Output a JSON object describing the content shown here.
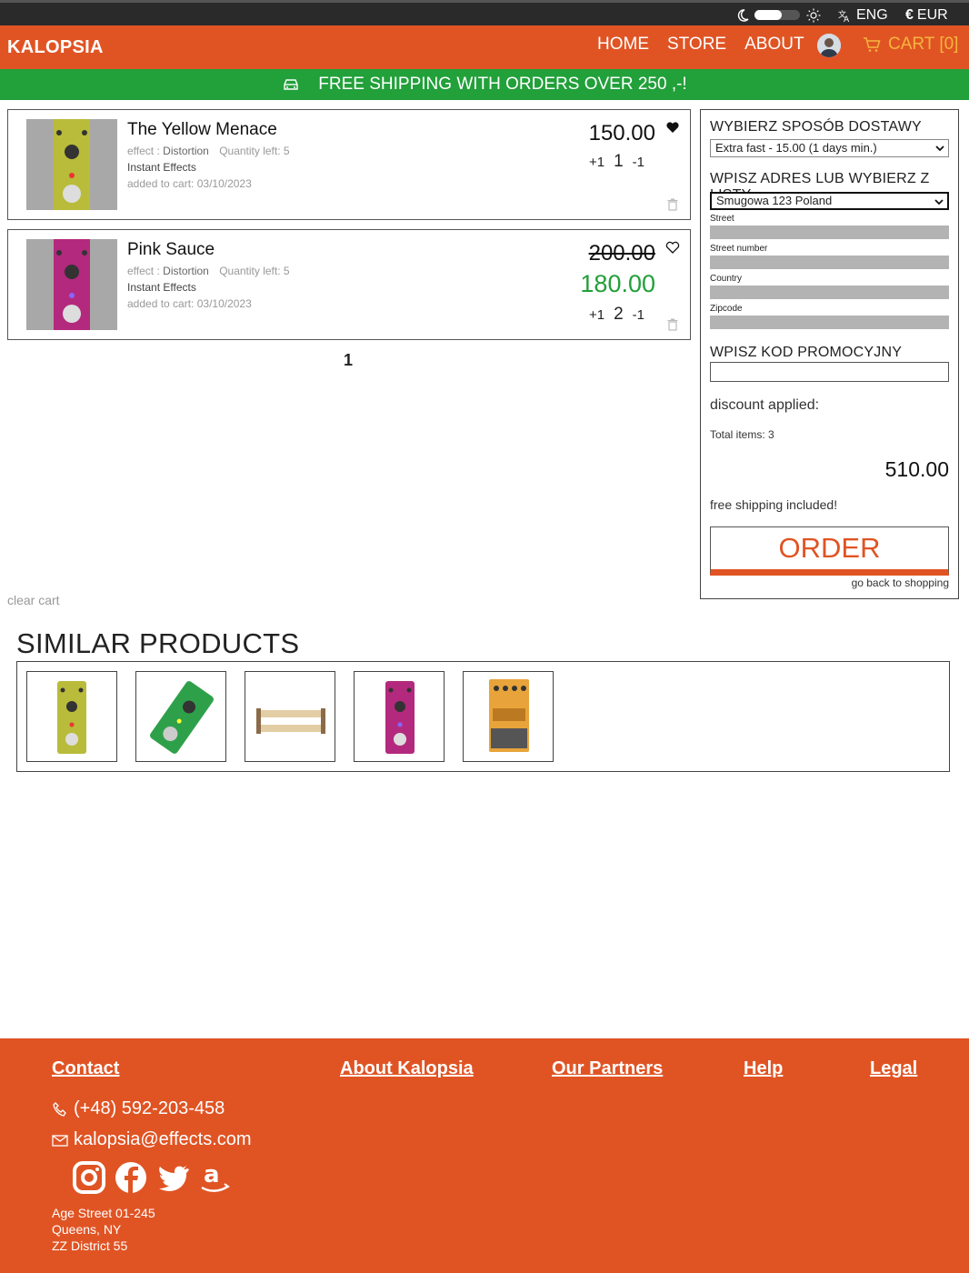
{
  "topbar": {
    "language": "ENG",
    "currency": "EUR"
  },
  "nav": {
    "logo": "KALOPSIA",
    "links": [
      "HOME",
      "STORE",
      "ABOUT"
    ],
    "cart_label": "CART [0]"
  },
  "banner": {
    "text": "FREE SHIPPING WITH ORDERS OVER 250 ,-!"
  },
  "cart": {
    "items": [
      {
        "name": "The Yellow Menace",
        "effect_label": "effect :",
        "effect": "Distortion",
        "quantity_left": "Quantity left: 5",
        "brand": "Instant Effects",
        "added": "added to cart: 03/10/2023",
        "price": "150.00",
        "qty_plus": "+1",
        "qty": "1",
        "qty_minus": "-1",
        "favorite": true
      },
      {
        "name": "Pink Sauce",
        "effect_label": "effect :",
        "effect": "Distortion",
        "quantity_left": "Quantity left: 5",
        "brand": "Instant Effects",
        "added": "added to cart: 03/10/2023",
        "old_price": "200.00",
        "price": "180.00",
        "qty_plus": "+1",
        "qty": "2",
        "qty_minus": "-1",
        "favorite": false
      }
    ],
    "page": "1",
    "clear_label": "clear cart"
  },
  "checkout": {
    "delivery_label": "WYBIERZ SPOSÓB DOSTAWY",
    "delivery_value": "Extra fast - 15.00 (1 days min.)",
    "address_label": "WPISZ ADRES LUB WYBIERZ Z LISTY",
    "address_value": "Smugowa 123 Poland",
    "fields": [
      "Street",
      "Street number",
      "Country",
      "Zipcode"
    ],
    "promo_label": "WPISZ KOD PROMOCYJNY",
    "promo_value": "",
    "discount": "discount applied:",
    "total_items": "Total items: 3",
    "total": "510.00",
    "free_shipping": "free shipping included!",
    "order_label": "ORDER",
    "back_label": "go back to shopping"
  },
  "similar": {
    "title": "SIMILAR PRODUCTS",
    "products": [
      "yellow-pedal",
      "green-pedal",
      "pedalboard",
      "pink-pedal",
      "orange-boss-pedal"
    ]
  },
  "footer": {
    "links": [
      "Contact",
      "About Kalopsia",
      "Our Partners",
      "Help",
      "Legal"
    ],
    "phone": "(+48) 592-203-458",
    "email": "kalopsia@effects.com",
    "socials": [
      "instagram-icon",
      "facebook-icon",
      "twitter-icon",
      "amazon-icon"
    ],
    "address": [
      "Age Street 01-245",
      "Queens, NY",
      "ZZ District 55"
    ]
  },
  "colors": {
    "brand": "#e05424",
    "banner": "#22a03a",
    "cart_accent": "#f5b53c",
    "sale_price": "#22a03a"
  }
}
